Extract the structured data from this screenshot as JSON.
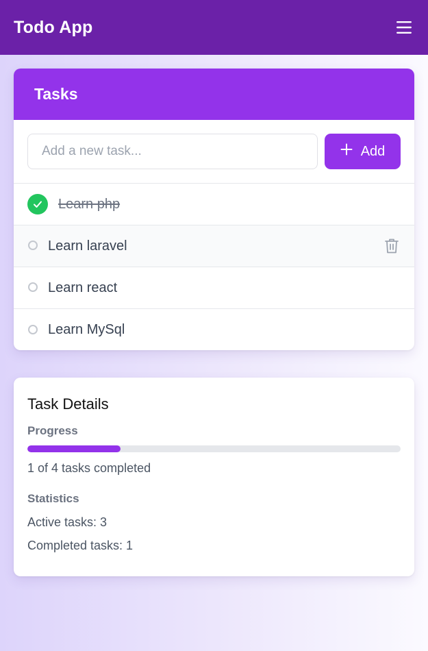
{
  "header": {
    "title": "Todo App",
    "menu_icon": "hamburger-menu-icon",
    "bg_color": "#6b21a8"
  },
  "tasks_panel": {
    "title": "Tasks",
    "accent_color": "#9333ea",
    "input": {
      "placeholder": "Add a new task...",
      "value": ""
    },
    "add_button": {
      "label": "Add",
      "icon": "plus-icon"
    },
    "items": [
      {
        "label": "Learn php",
        "completed": true,
        "icon": "check-circle-icon"
      },
      {
        "label": "Learn laravel",
        "completed": false,
        "hovered": true,
        "action_icon": "trash-icon"
      },
      {
        "label": "Learn react",
        "completed": false
      },
      {
        "label": "Learn MySql",
        "completed": false
      }
    ]
  },
  "details_panel": {
    "title": "Task Details",
    "progress": {
      "label": "Progress",
      "completed": 1,
      "total": 4,
      "fraction": 0.25,
      "text": "1 of 4 tasks completed"
    },
    "statistics": {
      "label": "Statistics",
      "active": "Active tasks: 3",
      "completed": "Completed tasks: 1"
    }
  },
  "colors": {
    "success": "#22c55e",
    "accent": "#9333ea"
  }
}
